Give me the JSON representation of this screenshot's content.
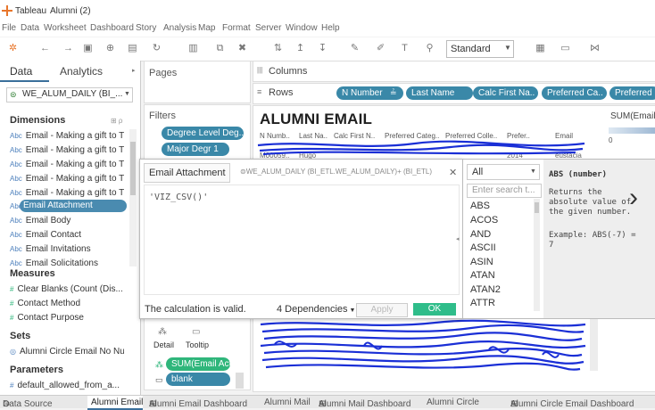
{
  "app": {
    "name": "Tableau",
    "workbook": "Alumni (2)"
  },
  "menu": [
    "File",
    "Data",
    "Worksheet",
    "Dashboard",
    "Story",
    "Analysis",
    "Map",
    "Format",
    "Server",
    "Window",
    "Help"
  ],
  "toolbar": {
    "fit_option": "Standard"
  },
  "left": {
    "tabs": {
      "data": "Data",
      "analytics": "Analytics"
    },
    "datasource": "WE_ALUM_DAILY (BI_...",
    "dimensions_header": "Dimensions",
    "dimensions": [
      "Email - Making a gift to T...",
      "Email - Making a gift to T...",
      "Email - Making a gift to T...",
      "Email - Making a gift to T...",
      "Email - Making a gift to T...",
      "Email Attachment",
      "Email Body",
      "Email Contact",
      "Email Invitations",
      "Email Solicitations"
    ],
    "measures_header": "Measures",
    "measures": [
      "Clear Blanks (Count (Dis...",
      "Contact Method",
      "Contact Purpose"
    ],
    "sets_header": "Sets",
    "sets": [
      "Alumni Circle Email No Nulls"
    ],
    "parameters_header": "Parameters",
    "parameters": [
      "default_allowed_from_a..."
    ]
  },
  "pages": {
    "label": "Pages"
  },
  "filters": {
    "label": "Filters",
    "items": [
      "Degree Level Deg...",
      "Major Degr 1"
    ]
  },
  "marks": {
    "detail": "Detail",
    "tooltip": "Tooltip",
    "sum_pill": "SUM(Email Act...",
    "blank_pill": "blank"
  },
  "shelves": {
    "columns_label": "Columns",
    "rows_label": "Rows",
    "rows": [
      "N Number",
      "Last Name",
      "Calc First Na..",
      "Preferred Ca..",
      "Preferred"
    ]
  },
  "viz": {
    "title": "ALUMNI EMAIL",
    "headers": [
      "N Numb..",
      "Last Na..",
      "Calc First N..",
      "Preferred Categ..",
      "Preferred Colle..",
      "Prefer..",
      "Email"
    ],
    "row1": [
      "M00059..",
      "Hugo",
      "",
      "",
      "",
      "2014",
      "eustacia"
    ],
    "sum_header": "SUM(Email",
    "sum_axis": "0"
  },
  "calc": {
    "name": "Email Attachment",
    "source": "WE_ALUM_DAILY (BI_ETL.WE_ALUM_DAILY)+ (BI_ETL)",
    "formula": "'VIZ_CSV()'",
    "status": "The calculation is valid.",
    "dependencies": "4 Dependencies",
    "apply": "Apply",
    "ok": "OK"
  },
  "functions": {
    "category": "All",
    "search_placeholder": "Enter search t...",
    "list": [
      "ABS",
      "ACOS",
      "AND",
      "ASCII",
      "ASIN",
      "ATAN",
      "ATAN2",
      "ATTR"
    ],
    "help_title": "ABS (number)",
    "help_text": "Returns the absolute value of the given number.",
    "example": "Example: ABS(-7) = 7"
  },
  "tabs": [
    "Data Source",
    "Alumni Email",
    "Alumni Email Dashboard",
    "Alumni Mail",
    "Alumni Mail Dashboard",
    "Alumni Circle",
    "Alumni Circle Email Dashboard"
  ]
}
